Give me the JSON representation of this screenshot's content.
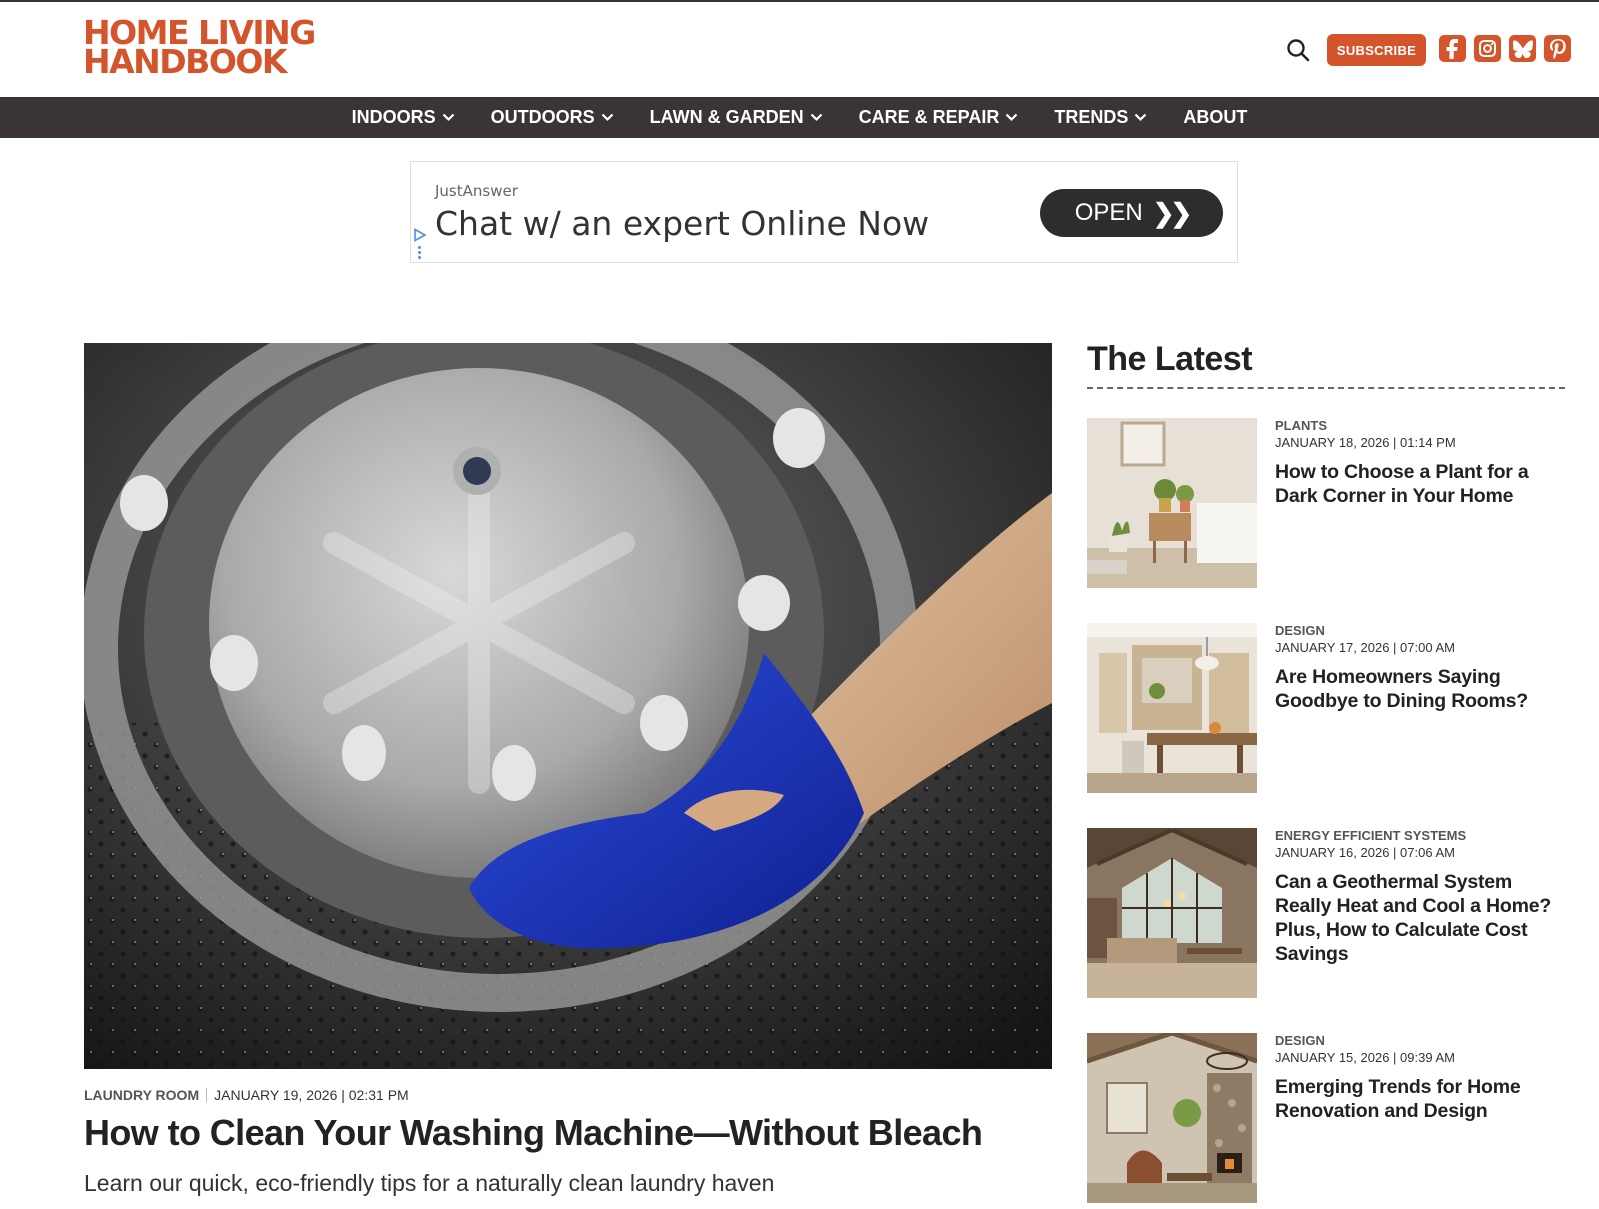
{
  "brand": {
    "logo_line1": "HOME LIVING",
    "logo_line2": "HANDBOOK",
    "accent_color": "#d4552c",
    "nav_bg": "#3a3434"
  },
  "header": {
    "search_icon": "search-icon",
    "subscribe_label": "SUBSCRIBE",
    "social_icons": [
      "facebook-icon",
      "instagram-icon",
      "bluesky-icon",
      "pinterest-icon"
    ]
  },
  "nav": {
    "items": [
      {
        "label": "INDOORS",
        "dropdown": true
      },
      {
        "label": "OUTDOORS",
        "dropdown": true
      },
      {
        "label": "LAWN & GARDEN",
        "dropdown": true
      },
      {
        "label": "CARE & REPAIR",
        "dropdown": true
      },
      {
        "label": "TRENDS",
        "dropdown": true
      },
      {
        "label": "ABOUT",
        "dropdown": false
      }
    ]
  },
  "ad": {
    "brand": "JustAnswer",
    "headline": "Chat w/ an expert Online Now",
    "cta": "OPEN"
  },
  "hero": {
    "category": "LAUNDRY ROOM",
    "date": "JANUARY 19, 2026 | 02:31 PM",
    "title": "How to Clean Your Washing Machine—Without Bleach",
    "subtitle": "Learn our quick, eco-friendly tips for a naturally clean laundry haven"
  },
  "sidebar": {
    "title": "The Latest",
    "articles": [
      {
        "category": "PLANTS",
        "date": "JANUARY 18, 2026 | 01:14 PM",
        "title": "How to Choose a Plant for a Dark Corner in Your Home"
      },
      {
        "category": "DESIGN",
        "date": "JANUARY 17, 2026 | 07:00 AM",
        "title": "Are Homeowners Saying Goodbye to Dining Rooms?"
      },
      {
        "category": "ENERGY EFFICIENT SYSTEMS",
        "date": "JANUARY 16, 2026 | 07:06 AM",
        "title": "Can a Geothermal System Really Heat and Cool a Home? Plus, How to Calculate Cost Savings"
      },
      {
        "category": "DESIGN",
        "date": "JANUARY 15, 2026 | 09:39 AM",
        "title": "Emerging Trends for Home Renovation and Design"
      }
    ]
  }
}
